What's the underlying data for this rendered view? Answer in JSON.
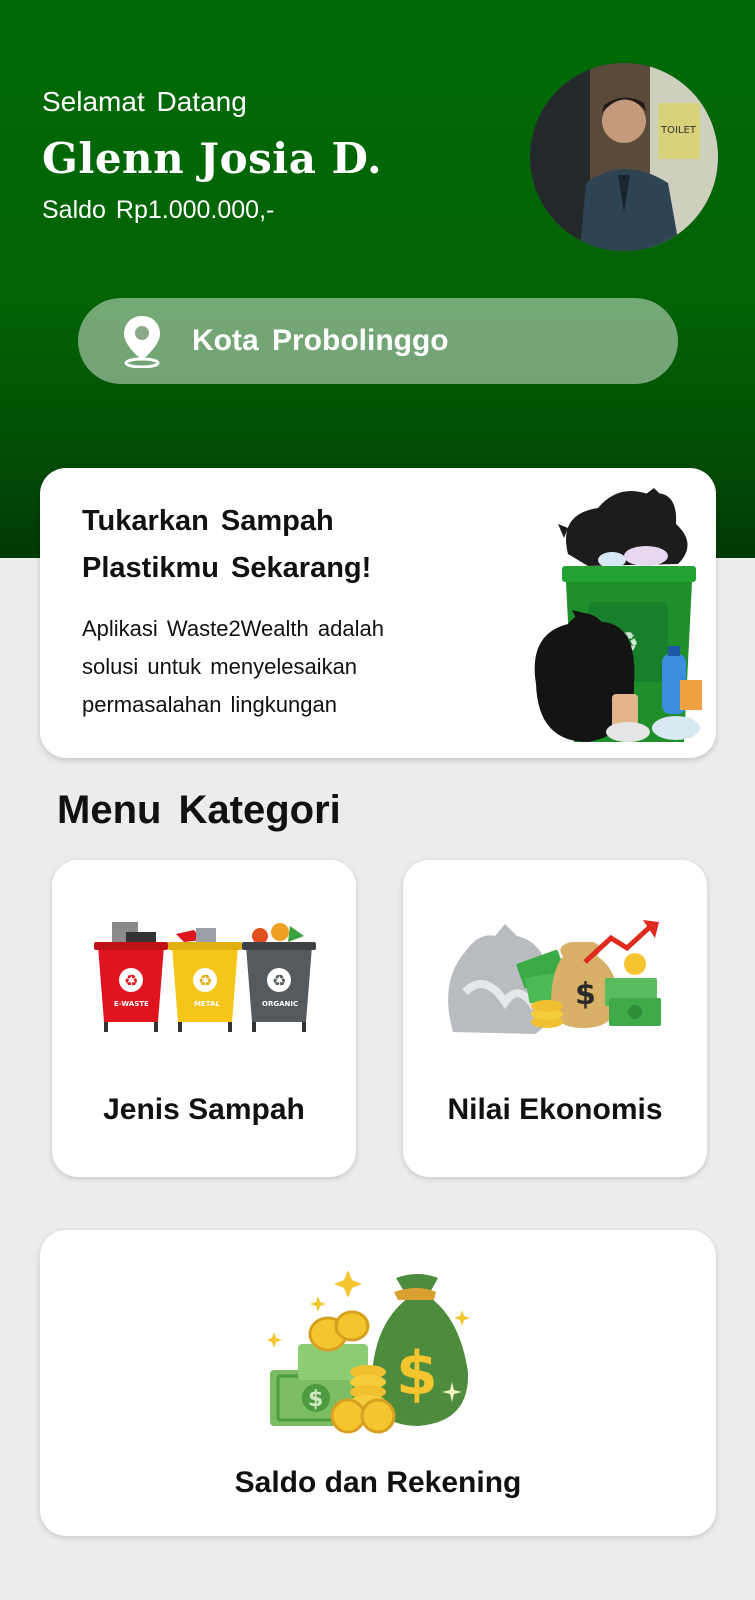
{
  "header": {
    "greeting": "Selamat Datang",
    "user_name": "Glenn Josia D.",
    "balance_text": "Saldo Rp1.000.000,-"
  },
  "location": {
    "icon": "map-pin-icon",
    "city": "Kota Probolinggo"
  },
  "promo": {
    "title_line1": "Tukarkan Sampah",
    "title_line2": "Plastikmu Sekarang!",
    "description_line1": "Aplikasi Waste2Wealth adalah",
    "description_line2": "solusi untuk menyelesaikan",
    "description_line3": "permasalahan lingkungan"
  },
  "menu": {
    "section_title": "Menu Kategori",
    "categories": [
      {
        "label": "Jenis Sampah",
        "icon": "waste-bins-icon",
        "bins": [
          "E-WASTE",
          "METAL",
          "ORGANIC"
        ]
      },
      {
        "label": "Nilai Ekonomis",
        "icon": "money-growth-icon"
      }
    ],
    "balance_card": {
      "label": "Saldo dan Rekening",
      "icon": "money-bag-icon"
    }
  },
  "colors": {
    "header_green": "#006b06",
    "background": "#ececec",
    "card": "#ffffff"
  }
}
